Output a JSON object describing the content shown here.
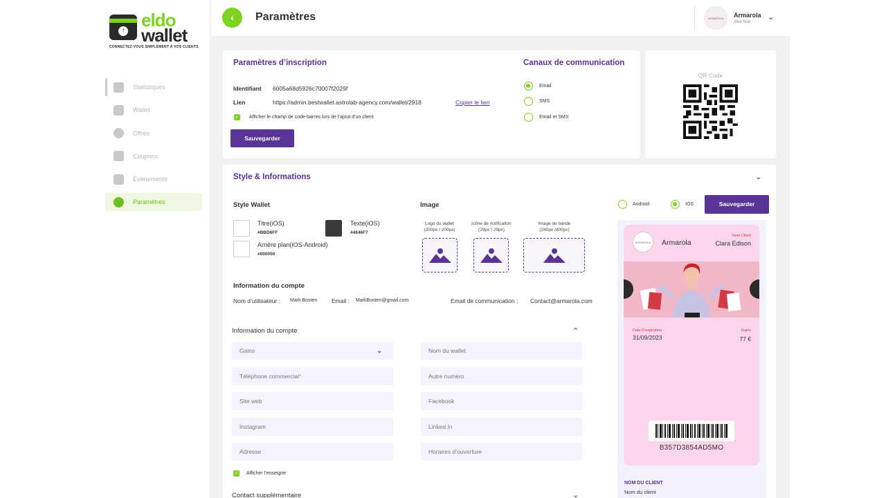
{
  "brand": {
    "word1": "eldo",
    "word2": "wallet",
    "tagline": "CONNECTEZ-VOUS SIMPLEMENT À VOS CLIENTS"
  },
  "sidebar": {
    "items": [
      {
        "label": "Statistiques",
        "icon": "pie-chart-icon"
      },
      {
        "label": "Wallet",
        "icon": "wallet-icon"
      },
      {
        "label": "Offres",
        "icon": "offers-icon"
      },
      {
        "label": "Coupons",
        "icon": "coupons-icon"
      },
      {
        "label": "Évènements",
        "icon": "events-icon"
      },
      {
        "label": "Paramètres",
        "icon": "gear-icon"
      }
    ]
  },
  "header": {
    "title": "Paramètres",
    "user_name": "Armarola",
    "user_sub": "Alex Noe",
    "avatar_text": "ARMAROLA"
  },
  "registration": {
    "title": "Paramètres d’inscription",
    "identifiant_label": "Identifiant",
    "identifiant_value": "6005a68d5926c70007f2029f",
    "lien_label": "Lien",
    "lien_value": "https://admin.bestwallet.astrolab-agency.com/wallet/2918",
    "copy_link": "Copier le lien",
    "barcode_checkbox": "Afficher le champ de code-barres lors de l’ajout d’un client",
    "save": "Sauvegarder"
  },
  "channels": {
    "title": "Canaux de communication",
    "options": [
      "Email",
      "SMS",
      "Email et SMS"
    ],
    "selected": "Email"
  },
  "qr": {
    "label": "QR Code"
  },
  "style": {
    "title": "Style & Informations",
    "style_wallet": "Style Wallet",
    "swatches": [
      {
        "name": "Titre(iOS)",
        "hex": "#BBD6FF",
        "color": "#ffffff"
      },
      {
        "name": "Texte(iOS)",
        "hex": "#4646F7",
        "color": "#3a3a3a"
      },
      {
        "name": "Arrière plan(iOS-Android)",
        "hex": "#000000",
        "color": "#ffffff"
      }
    ],
    "image_title": "Image",
    "images": [
      {
        "l1": "Logo du wallet",
        "l2": "(200px / 200px)"
      },
      {
        "l1": "icône de notification",
        "l2": "(29px / 29px)"
      },
      {
        "l1": "Image de bande",
        "l2": "(240px /400px)"
      }
    ],
    "platform": {
      "android": "Android",
      "ios": "IOS",
      "selected": "IOS",
      "save": "Sauvegarder"
    }
  },
  "account": {
    "title": "Information du compte",
    "username_label": "Nom d’utilisateur :",
    "username": "Mark Bosten",
    "email_label": "Email :",
    "email": "MarkBosten@gmail.com",
    "comm_email_label": "Email de communication :",
    "comm_email": "Contact@armarola.com"
  },
  "account_form": {
    "title": "Information du compte",
    "fields": [
      {
        "label": "Gains",
        "dropdown": true
      },
      {
        "label": "Nom du wallet"
      },
      {
        "label": "Téléphone commercial",
        "required": true
      },
      {
        "label": "Autre numéro"
      },
      {
        "label": "Site web"
      },
      {
        "label": "Facebook"
      },
      {
        "label": "Instagram"
      },
      {
        "label": "Linked In"
      },
      {
        "label": "Adresse"
      },
      {
        "label": "Horaires d’ouverture"
      }
    ],
    "show_sign": "Afficher l’enseigne",
    "extra_contact": "Contact supplémentaire"
  },
  "pass": {
    "brand": "Armarola",
    "logo_text": "ARMAROLA",
    "client_label": "Nom Client",
    "client_name": "Clara Edison",
    "date_label": "Date D'expiration",
    "date": "31/09/2023",
    "gain_label": "Gains",
    "gain": "77 €",
    "barcode": "B357D3854AD5MO",
    "below_label": "NOM DU CLIENT",
    "below_value": "Nom du client"
  },
  "colors": {
    "accent_green": "#7ed321",
    "brand_purple": "#5a3396",
    "pass_pink": "#fbd5e9"
  }
}
